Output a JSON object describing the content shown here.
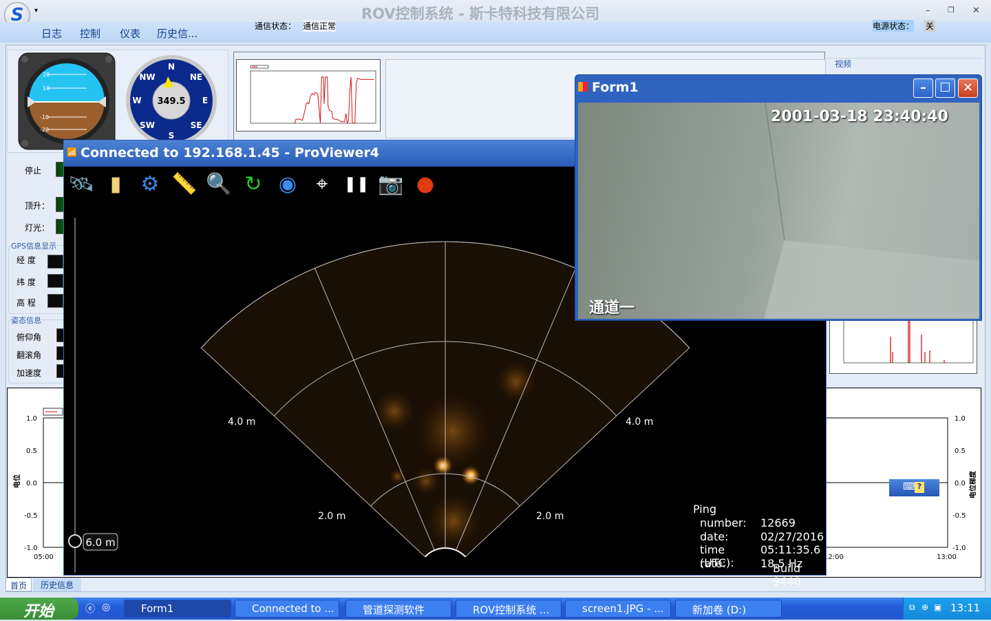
{
  "app": {
    "title": "ROV控制系统 - 斯卡特科技有限公司",
    "logo": "S",
    "menu": [
      "日志",
      "控制",
      "仪表",
      "历史信..."
    ],
    "comm_label": "通信状态：",
    "comm_value": "通信正常",
    "power_label": "电源状态：",
    "power_value": "关"
  },
  "left": {
    "heading_value": "349.5",
    "compass": [
      "N",
      "NE",
      "E",
      "SE",
      "S",
      "SW",
      "W",
      "NW"
    ],
    "attitude_marks": [
      "20",
      "10",
      "-10",
      "-20"
    ],
    "controls": [
      "停止",
      "顶升：",
      "灯光："
    ],
    "gps_group": "GPS信息显示",
    "gps": [
      "经  度",
      "纬  度",
      "高  程"
    ],
    "att_group": "姿态信息",
    "att": [
      "俯仰角",
      "翻滚角",
      "加速度"
    ]
  },
  "video_group": "视频",
  "bottom_chart": {
    "left_ylabel": "电位",
    "right_ylabel": "电位梯度",
    "yticks": [
      "1.0",
      "0.5",
      "0.0",
      "-0.5",
      "-1.0"
    ],
    "x_start": "05:00",
    "x_mid": "12:00",
    "x_end": "13:00"
  },
  "tabs": [
    "首页",
    "历史信息"
  ],
  "sonar": {
    "title": "Connected to 192.168.1.45 - ProViewer4",
    "tools": [
      "satellite-icon",
      "folder-icon",
      "settings-icon",
      "ruler-icon",
      "magnifier-icon",
      "refresh-icon",
      "sonar-signal-icon",
      "crosshair-icon",
      "pause-icon",
      "camera-icon",
      "record-icon"
    ],
    "range_labels": [
      "2.0 m",
      "4.0 m"
    ],
    "range_slider": "6.0 m",
    "ping_title": "Ping",
    "ping": [
      [
        "number:",
        "12669"
      ],
      [
        "date:",
        "02/27/2016"
      ],
      [
        "time (UTC):",
        "05:11:35.6"
      ],
      [
        "rate:",
        "18.5 Hz"
      ]
    ],
    "build": "Build 9440"
  },
  "form1": {
    "title": "Form1",
    "timestamp": "2001-03-18 23:40:40",
    "channel": "通道一"
  },
  "taskbar": {
    "start": "开始",
    "tasks": [
      "Form1",
      "Connected to ...",
      "管道探测软件",
      "ROV控制系统 ...",
      "screen1.JPG - ...",
      "新加卷 (D:)"
    ],
    "clock": "13:11"
  },
  "colors": {
    "accent": "#2a5cb6",
    "sonar_echo": "#ffb347",
    "trace": "#d40000"
  }
}
